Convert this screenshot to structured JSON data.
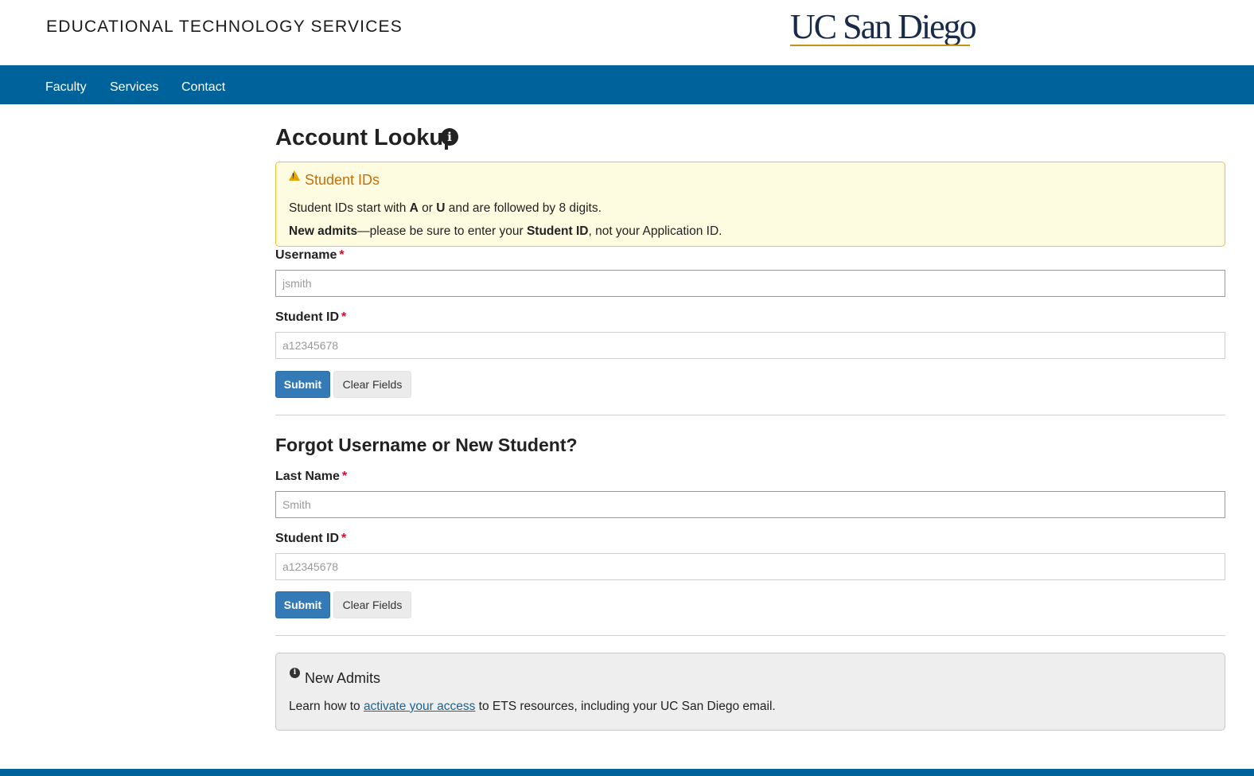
{
  "header": {
    "site_title": "EDUCATIONAL TECHNOLOGY SERVICES",
    "logo_text": "UC San Diego"
  },
  "nav": {
    "items": [
      {
        "label": "Faculty"
      },
      {
        "label": "Services"
      },
      {
        "label": "Contact"
      }
    ]
  },
  "account_lookup": {
    "title": "Account Lookup",
    "info_icon": "info-circle-icon",
    "alert": {
      "icon": "warning-icon",
      "title": "Student IDs",
      "line1": {
        "prefix": "Student IDs start with ",
        "bold_a": "A",
        "or": " or ",
        "bold_u": "U",
        "suffix": " and are followed by 8 digits."
      },
      "line2": {
        "bold_new_admits": "New admits",
        "middle": "—please be sure to enter your ",
        "bold_student_id": "Student ID",
        "suffix": ", not your Application ID."
      }
    },
    "username_label": "Username",
    "username_placeholder": "jsmith",
    "student_id_label": "Student ID",
    "student_id_placeholder": "a12345678",
    "required_mark": "*",
    "submit_label": "Submit",
    "clear_label": "Clear Fields"
  },
  "forgot": {
    "title": "Forgot Username or New Student?",
    "last_name_label": "Last Name",
    "last_name_placeholder": "Smith",
    "student_id_label": "Student ID",
    "student_id_placeholder": "a12345678",
    "required_mark": "*",
    "submit_label": "Submit",
    "clear_label": "Clear Fields"
  },
  "new_admits": {
    "icon": "info-circle-icon",
    "title": "New Admits",
    "prefix": "Learn how to ",
    "link": "activate your access",
    "suffix": " to ETS resources, including your UC San Diego email."
  },
  "colors": {
    "brand_navy": "#182b49",
    "brand_gold": "#c69214",
    "nav_blue": "#00629b",
    "button_blue": "#337ab7",
    "alert_bg": "#fefce0",
    "alert_border": "#f2bf39",
    "alert_title": "#c96d0a",
    "required_red": "#c8102e"
  }
}
